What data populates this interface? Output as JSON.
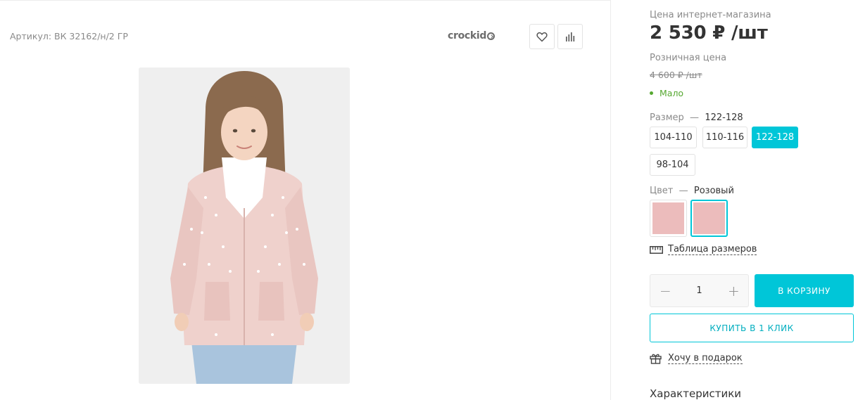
{
  "product": {
    "article": "Артикул: ВК 32162/н/2 ГР",
    "brand_name": "crockid"
  },
  "pricing": {
    "online_label": "Цена интернет-магазина",
    "online_price": "2 530 ₽ /шт",
    "retail_label": "Розничная цена",
    "retail_price": "4 600 ₽ /шт",
    "stock_status": "Мало",
    "stock_color": "#56a831"
  },
  "size": {
    "label": "Размер",
    "separator": "—",
    "selected": "122-128",
    "options": [
      "104-110",
      "110-116",
      "122-128",
      "98-104"
    ]
  },
  "color": {
    "label": "Цвет",
    "separator": "—",
    "selected": "Розовый",
    "swatch_color": "#ecbcbc"
  },
  "size_table_link": "Таблица размеров",
  "quantity": {
    "value": "1",
    "minus": "−",
    "plus": "+"
  },
  "buttons": {
    "add_to_cart": "В КОРЗИНУ",
    "buy_one_click": "КУПИТЬ В 1 КЛИК"
  },
  "gift_link": "Хочу в подарок",
  "specs_heading": "Характеристики",
  "theme": {
    "accent": "#00c6d8",
    "text": "#333333",
    "muted": "#8a8a8a"
  },
  "icons": [
    "heart-icon",
    "bar-chart-icon",
    "ruler-icon",
    "gift-icon"
  ]
}
